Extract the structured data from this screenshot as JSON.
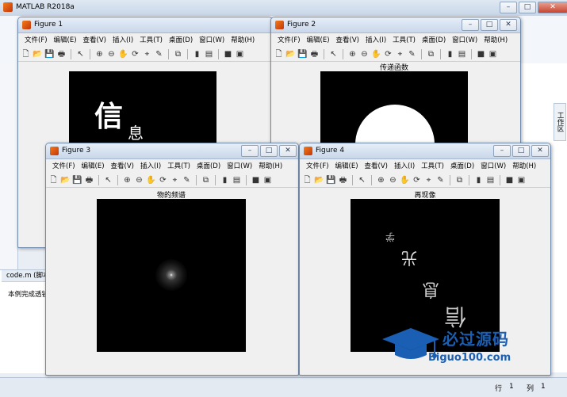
{
  "main": {
    "title": "MATLAB R2018a",
    "code_tab": "code.m  (脚本)",
    "code_text": "本例完成透镜",
    "side_tab": "工作区",
    "status": {
      "row_label": "行",
      "row": "1",
      "col_label": "列",
      "col": "1"
    }
  },
  "menu": [
    "文件(F)",
    "编辑(E)",
    "查看(V)",
    "插入(I)",
    "工具(T)",
    "桌面(D)",
    "窗口(W)",
    "帮助(H)"
  ],
  "figures": {
    "f1": {
      "title": "Figure 1",
      "plot_title": "",
      "glyphs": [
        "信",
        "息"
      ]
    },
    "f2": {
      "title": "Figure 2",
      "plot_title": "传递函数"
    },
    "f3": {
      "title": "Figure 3",
      "plot_title": "物的频谱"
    },
    "f4": {
      "title": "Figure 4",
      "plot_title": "再现像",
      "glyphs": [
        "信",
        "息",
        "光",
        "学"
      ]
    }
  },
  "watermark": {
    "text": "必过源码",
    "url": "Biguo100.com"
  },
  "colors": {
    "accent": "#1a5fb4",
    "plot_bg": "#000000"
  }
}
